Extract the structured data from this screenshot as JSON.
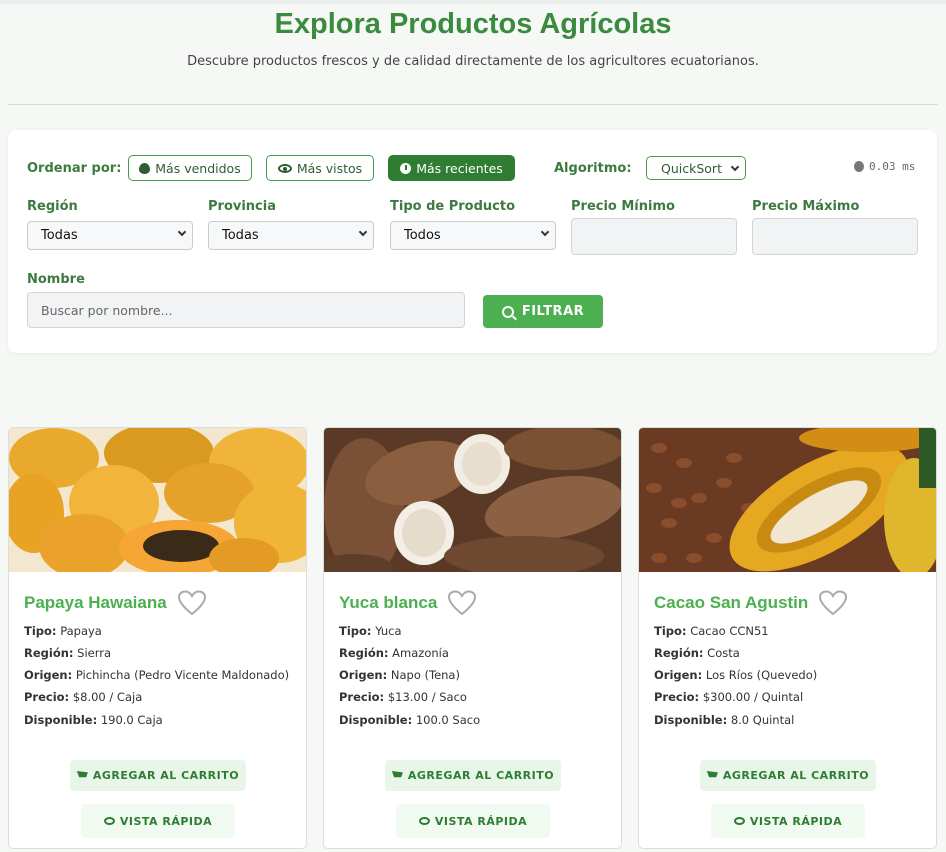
{
  "header": {
    "title": "Explora Productos Agrícolas",
    "subtitle": "Descubre productos frescos y de calidad directamente de los agricultores ecuatorianos."
  },
  "filters": {
    "sort_label": "Ordenar por:",
    "sort_options": [
      {
        "label": "Más vendidos",
        "icon": "fire-icon",
        "active": false
      },
      {
        "label": "Más vistos",
        "icon": "eye-icon",
        "active": false
      },
      {
        "label": "Más recientes",
        "icon": "clock-icon",
        "active": true
      }
    ],
    "algorithm_label": "Algoritmo:",
    "algorithm_value": "QuickSort",
    "timer": "0.03 ms",
    "region_label": "Región",
    "region_value": "Todas",
    "province_label": "Provincia",
    "province_value": "Todas",
    "type_label": "Tipo de Producto",
    "type_value": "Todos",
    "min_price_label": "Precio Mínimo",
    "max_price_label": "Precio Máximo",
    "name_label": "Nombre",
    "name_placeholder": "Buscar por nombre...",
    "filter_button": "FILTRAR"
  },
  "products": [
    {
      "name": "Papaya Hawaiana",
      "tipo": "Papaya",
      "region": "Sierra",
      "origen": "Pichincha (Pedro Vicente Maldonado)",
      "precio": "$8.00 / Caja",
      "disponible": "190.0 Caja"
    },
    {
      "name": "Yuca blanca",
      "tipo": "Yuca",
      "region": "Amazonía",
      "origen": "Napo (Tena)",
      "precio": "$13.00 / Saco",
      "disponible": "100.0 Saco"
    },
    {
      "name": "Cacao San Agustin",
      "tipo": "Cacao CCN51",
      "region": "Costa",
      "origen": "Los Ríos (Quevedo)",
      "precio": "$300.00 / Quintal",
      "disponible": "8.0 Quintal"
    }
  ],
  "labels": {
    "tipo": "Tipo:",
    "region": "Región:",
    "origen": "Origen:",
    "precio": "Precio:",
    "disponible": "Disponible:",
    "add_to_cart": "AGREGAR AL CARRITO",
    "quick_view": "VISTA RÁPIDA"
  },
  "colors": {
    "brand_green": "#3a8a3f",
    "accent_green": "#4caf50",
    "active_button": "#2e7d32"
  }
}
